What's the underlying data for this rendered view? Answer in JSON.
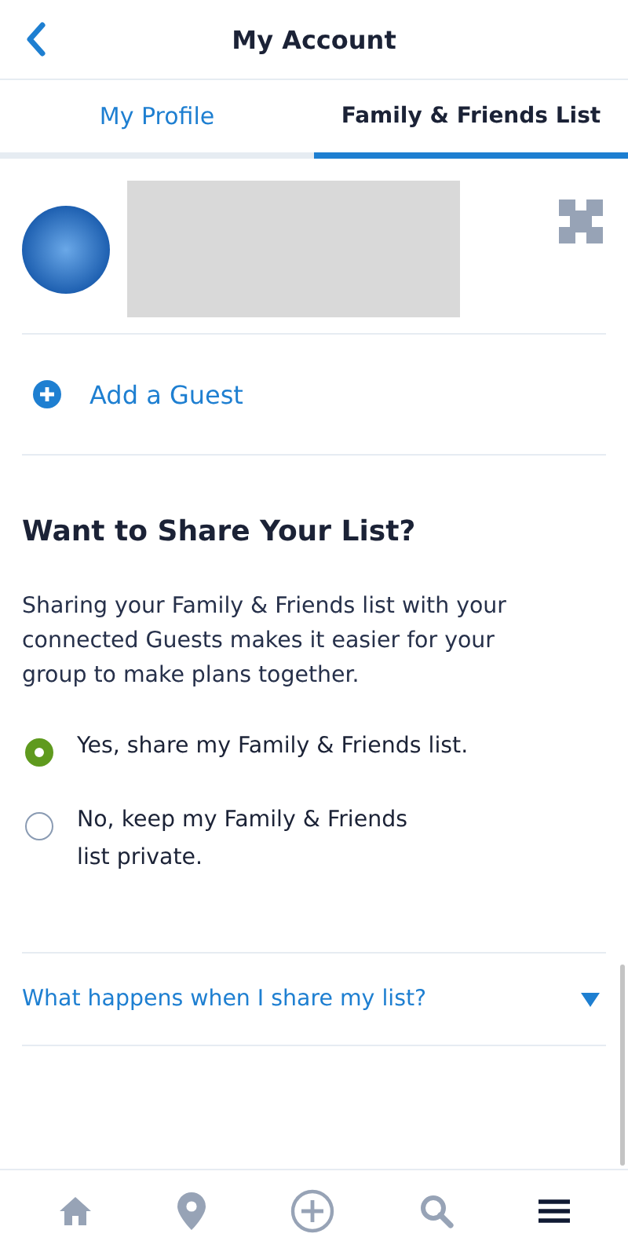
{
  "header": {
    "title": "My Account"
  },
  "tabs": [
    {
      "label": "My Profile",
      "selected": false
    },
    {
      "label": "Family & Friends List",
      "selected": true
    }
  ],
  "add_guest": {
    "label": "Add a Guest"
  },
  "share": {
    "heading": "Want to Share Your List?",
    "description": "Sharing your Family & Friends list with your connected Guests makes it easier for your group to make plans together.",
    "options": [
      {
        "lines": [
          "Yes, share my Family & Friends list."
        ],
        "selected": true
      },
      {
        "lines": [
          "No, keep my Family & Friends",
          "list private."
        ],
        "selected": false
      }
    ]
  },
  "faq": {
    "label": "What happens when I share my list?",
    "expanded": false
  },
  "bottom_nav": [
    {
      "kind": "home",
      "selected": false
    },
    {
      "kind": "pin",
      "selected": false
    },
    {
      "kind": "plus",
      "selected": false
    },
    {
      "kind": "search",
      "selected": false
    },
    {
      "kind": "menu",
      "selected": true
    }
  ]
}
